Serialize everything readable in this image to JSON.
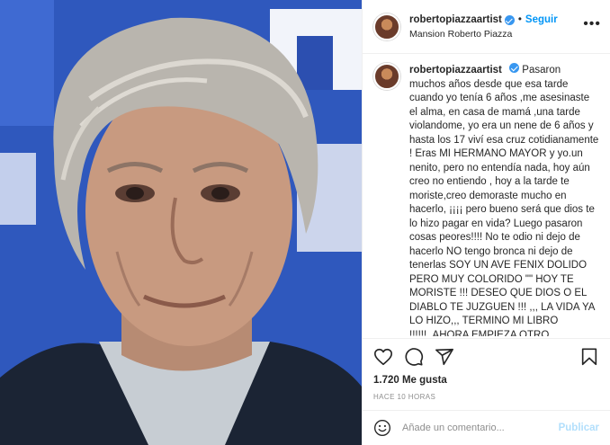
{
  "post": {
    "username": "robertopiazzaartist",
    "follow_label": "Seguir",
    "separator": "•",
    "location": "Mansion Roberto Piazza",
    "more_label": "•••",
    "caption": "Pasaron muchos años desde que esa tarde cuando yo tenía 6 años ,me asesinaste el alma, en casa de mamá ,una tarde violandome, yo era un nene de 6 años y hasta los 17 viví esa cruz cotidianamente ! Eras MI HERMANO MAYOR y yo.un nenito, pero no entendía nada, hoy aún creo no entiendo , hoy a la tarde te moriste,creo demoraste mucho en hacerlo, ¡¡¡¡ pero bueno será que dios te lo hizo pagar en vida? Luego pasaron cosas peores!!!! No te odio ni dejo de hacerlo NO tengo bronca ni dejo de tenerlas SOY UN AVE FENIX DOLIDO PERO MUY COLORIDO \"\" HOY TE MORISTE !!! DESEO QUE DIOS O EL DIABLO TE JUZGUEN !!! ,,, LA VIDA YA LO HIZO,,, TERMINO MI LIBRO !!!!!!,,AHORA EMPIEZA OTRO",
    "likes": "1.720 Me gusta",
    "time": "HACE 10 HORAS"
  },
  "comment": {
    "placeholder": "Añade un comentario...",
    "publish_label": "Publicar"
  },
  "icons": {
    "like": "heart-icon",
    "comment": "comment-icon",
    "share": "share-icon",
    "save": "bookmark-icon",
    "emoji": "emoji-icon"
  },
  "colors": {
    "accent": "#0095f6",
    "verified": "#3897f0",
    "publish_disabled": "#b2dffc",
    "muted": "#8e8e8e"
  }
}
